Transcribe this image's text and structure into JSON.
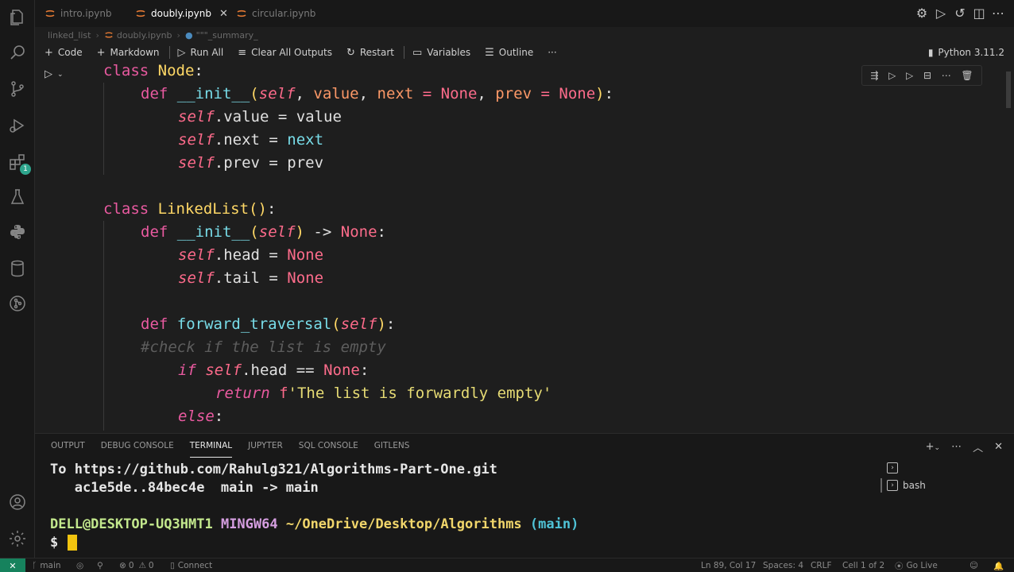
{
  "tabs": [
    {
      "label": "intro.ipynb",
      "active": false
    },
    {
      "label": "doubly.ipynb",
      "active": true
    },
    {
      "label": "circular.ipynb",
      "active": false
    }
  ],
  "breadcrumb": [
    "linked_list",
    "doubly.ipynb",
    "\"\"\"_summary_"
  ],
  "toolbar": {
    "code": "Code",
    "markdown": "Markdown",
    "run_all": "Run All",
    "clear_outputs": "Clear All Outputs",
    "restart": "Restart",
    "variables": "Variables",
    "outline": "Outline",
    "more": "···",
    "kernel": "Python 3.11.2"
  },
  "code_lines": [
    "class Node:",
    "def __init__(self, value, next = None, prev = None):",
    "self.value = value",
    "self.next = next",
    "self.prev = prev",
    "class LinkedList():",
    "def __init__(self) -> None:",
    "self.head = None",
    "self.tail = None",
    "def forward_traversal(self):",
    "#check if the list is empty",
    "if self.head == None:",
    "return f'The list is forwardly empty'",
    "else:"
  ],
  "panel": {
    "tabs": [
      "OUTPUT",
      "DEBUG CONSOLE",
      "TERMINAL",
      "JUPYTER",
      "SQL CONSOLE",
      "GITLENS"
    ],
    "active_tab": "TERMINAL",
    "terminal_list": [
      "",
      "bash"
    ]
  },
  "terminal": {
    "line1": "To https://github.com/Rahulg321/Algorithms-Part-One.git",
    "line2": "   ac1e5de..84bec4e  main -> main",
    "user_host": "DELL@DESKTOP-UQ3HMT1",
    "shell": "MINGW64",
    "path": "~/OneDrive/Desktop/Algorithms",
    "branch": "(main)",
    "prompt": "$"
  },
  "status": {
    "branch": "main",
    "errors": "0",
    "warnings": "0",
    "connect": "Connect",
    "position": "Ln 89, Col 17",
    "spaces": "Spaces: 4",
    "eol": "CRLF",
    "cell": "Cell 1 of 2",
    "golive": "Go Live"
  },
  "activity_badge": "1",
  "colors": {
    "accent": "#16825d",
    "cursor": "#f1c40f"
  }
}
